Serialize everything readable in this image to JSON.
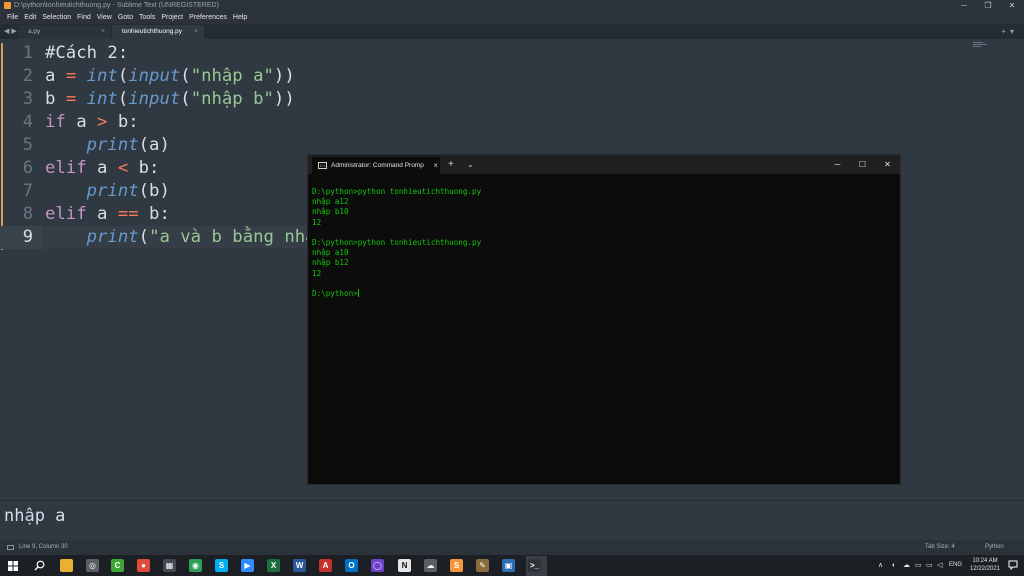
{
  "window": {
    "title": "D:\\python\\tonhieutichthuong.py - Sublime Text (UNREGISTERED)",
    "controls": [
      "─",
      "❐",
      "✕"
    ]
  },
  "menu": [
    "File",
    "Edit",
    "Selection",
    "Find",
    "View",
    "Goto",
    "Tools",
    "Project",
    "Preferences",
    "Help"
  ],
  "tabs": [
    {
      "label": "a.py",
      "close": "×"
    },
    {
      "label": "tonhieutichthuong.py",
      "close": "×"
    }
  ],
  "tabbar": {
    "nav": "◀ ▶",
    "right": "+▾"
  },
  "editor": {
    "current_line": 9,
    "line_numbers": [
      "1",
      "2",
      "3",
      "4",
      "5",
      "6",
      "7",
      "8",
      "9"
    ]
  },
  "terminal": {
    "tab_title": "Administrator: Command Promp",
    "tab_close": "×",
    "new_tab": "+",
    "dropdown": "⌄",
    "controls": [
      "─",
      "☐",
      "✕"
    ],
    "lines": [
      "D:\\python>python tonhieutichthuong.py",
      "nhập a12",
      "nhập b10",
      "12",
      "",
      "D:\\python>python tonhieutichthuong.py",
      "nhập a10",
      "nhập b12",
      "12",
      "",
      "D:\\python>"
    ]
  },
  "output_panel": {
    "text": "nhập a"
  },
  "status": {
    "position": "Line 9, Column 30",
    "tab_size": "Tab Size: 4",
    "syntax": "Python"
  },
  "taskbar": {
    "apps": [
      {
        "name": "file-explorer",
        "color": "#e8b130",
        "glyph": ""
      },
      {
        "name": "media",
        "color": "#5a5f66",
        "glyph": "◎"
      },
      {
        "name": "camtasia",
        "color": "#3fa535",
        "glyph": "C"
      },
      {
        "name": "chrome",
        "color": "#dd4b39",
        "glyph": "●"
      },
      {
        "name": "apps",
        "color": "#444a52",
        "glyph": "▦"
      },
      {
        "name": "green-app",
        "color": "#2f9e57",
        "glyph": "◉"
      },
      {
        "name": "skype",
        "color": "#00aff0",
        "glyph": "S"
      },
      {
        "name": "zoom",
        "color": "#2d8cff",
        "glyph": "▶"
      },
      {
        "name": "excel",
        "color": "#1d6f42",
        "glyph": "X"
      },
      {
        "name": "word",
        "color": "#2b579a",
        "glyph": "W"
      },
      {
        "name": "acrobat",
        "color": "#c4302b",
        "glyph": "A"
      },
      {
        "name": "outlook",
        "color": "#0072c6",
        "glyph": "O"
      },
      {
        "name": "github",
        "color": "#6e40c9",
        "glyph": "◯"
      },
      {
        "name": "notion",
        "color": "#e6e6e6",
        "glyph": "N"
      },
      {
        "name": "cloud",
        "color": "#5a5f66",
        "glyph": "☁"
      },
      {
        "name": "sublime",
        "color": "#f2973b",
        "glyph": "S"
      },
      {
        "name": "tool",
        "color": "#8a6d3b",
        "glyph": "✎"
      },
      {
        "name": "image",
        "color": "#2d6fb5",
        "glyph": "▣"
      },
      {
        "name": "terminal",
        "color": "#2f3237",
        "glyph": ">_"
      }
    ],
    "tray": {
      "chevron": "∧",
      "lang": "ENG",
      "time": "10:24 AM",
      "date": "12/22/2021"
    }
  }
}
